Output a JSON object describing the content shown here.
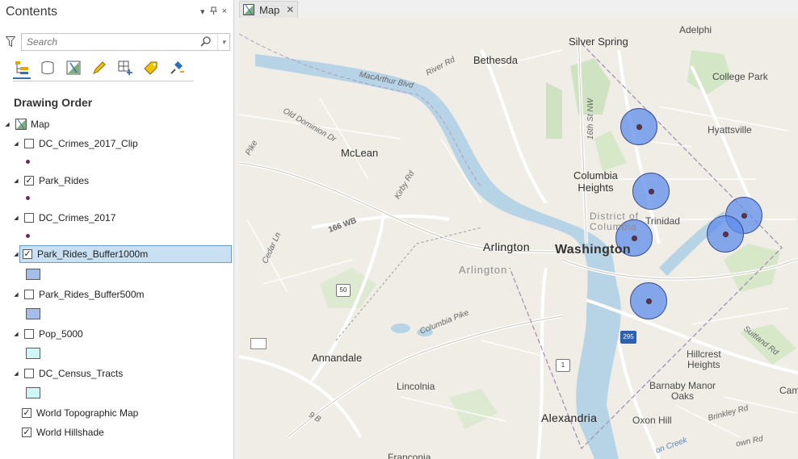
{
  "contents": {
    "title": "Contents",
    "controls": [
      "▾",
      "⊞",
      "×"
    ],
    "search": {
      "placeholder": "Search",
      "value": ""
    },
    "toolbar_icons": [
      "list-by-drawing-order-icon",
      "list-by-source-icon",
      "list-by-selection-icon",
      "list-by-editing-icon",
      "list-by-snapping-icon",
      "list-by-labeling-icon",
      "list-by-perspective-icon"
    ],
    "drawing_order_label": "Drawing Order",
    "map_node": "Map",
    "layers": [
      {
        "name": "DC_Crimes_2017_Clip",
        "checked": false,
        "symbol": "point"
      },
      {
        "name": "Park_Rides",
        "checked": true,
        "symbol": "point"
      },
      {
        "name": "DC_Crimes_2017",
        "checked": false,
        "symbol": "point"
      },
      {
        "name": "Park_Rides_Buffer1000m",
        "checked": true,
        "symbol": "polygon",
        "fill": "#a6bde7",
        "selected": true
      },
      {
        "name": "Park_Rides_Buffer500m",
        "checked": false,
        "symbol": "polygon",
        "fill": "#a6bde7"
      },
      {
        "name": "Pop_5000",
        "checked": false,
        "symbol": "polygon",
        "fill": "#cff5f7"
      },
      {
        "name": "DC_Census_Tracts",
        "checked": false,
        "symbol": "polygon",
        "fill": "#cff5f7"
      },
      {
        "name": "World Topographic Map",
        "checked": true,
        "symbol": "none"
      },
      {
        "name": "World Hillshade",
        "checked": true,
        "symbol": "none"
      }
    ]
  },
  "map_tab": {
    "label": "Map",
    "close": "✕"
  },
  "map": {
    "places": {
      "silver_spring": "Silver Spring",
      "adelphi": "Adelphi",
      "bethesda": "Bethesda",
      "college_park": "College Park",
      "hyattsville": "Hyattsville",
      "mclean": "McLean",
      "columbia_heights": "Columbia\nHeights",
      "trinidad": "Trinidad",
      "district_of_columbia": "District of\nColumbia",
      "arlington_city": "Arlington",
      "arlington_county": "Arlington",
      "washington": "Washington",
      "annandale": "Annandale",
      "lincolnia": "Lincolnia",
      "alexandria": "Alexandria",
      "oxon_hill": "Oxon Hill",
      "hillcrest_heights": "Hillcrest\nHeights",
      "barnaby_manor_oaks": "Barnaby Manor\nOaks",
      "franconia": "Franconia",
      "cam": "Cam"
    },
    "roads": {
      "river_rd": "River Rd",
      "macarthur_blvd": "MacArthur Blvd",
      "old_dominion": "Old Dominion Dr",
      "kirby_rd": "Kirby Rd",
      "st16": "16th St NW",
      "route_166": "166 WB",
      "cedar_ln": "Cedar Ln",
      "columbia_pike": "Columbia Pike",
      "route_50": "50",
      "route_1": "1",
      "route_295": "295",
      "suitland_rd": "Suitland Rd",
      "brinkley_rd": "Brinkley Rd",
      "oxon_run": "on Creek",
      "towntown": "own Rd",
      "pike": "Pike",
      "g_b": "9 B"
    },
    "buffer_color": "#5f8ceb"
  }
}
